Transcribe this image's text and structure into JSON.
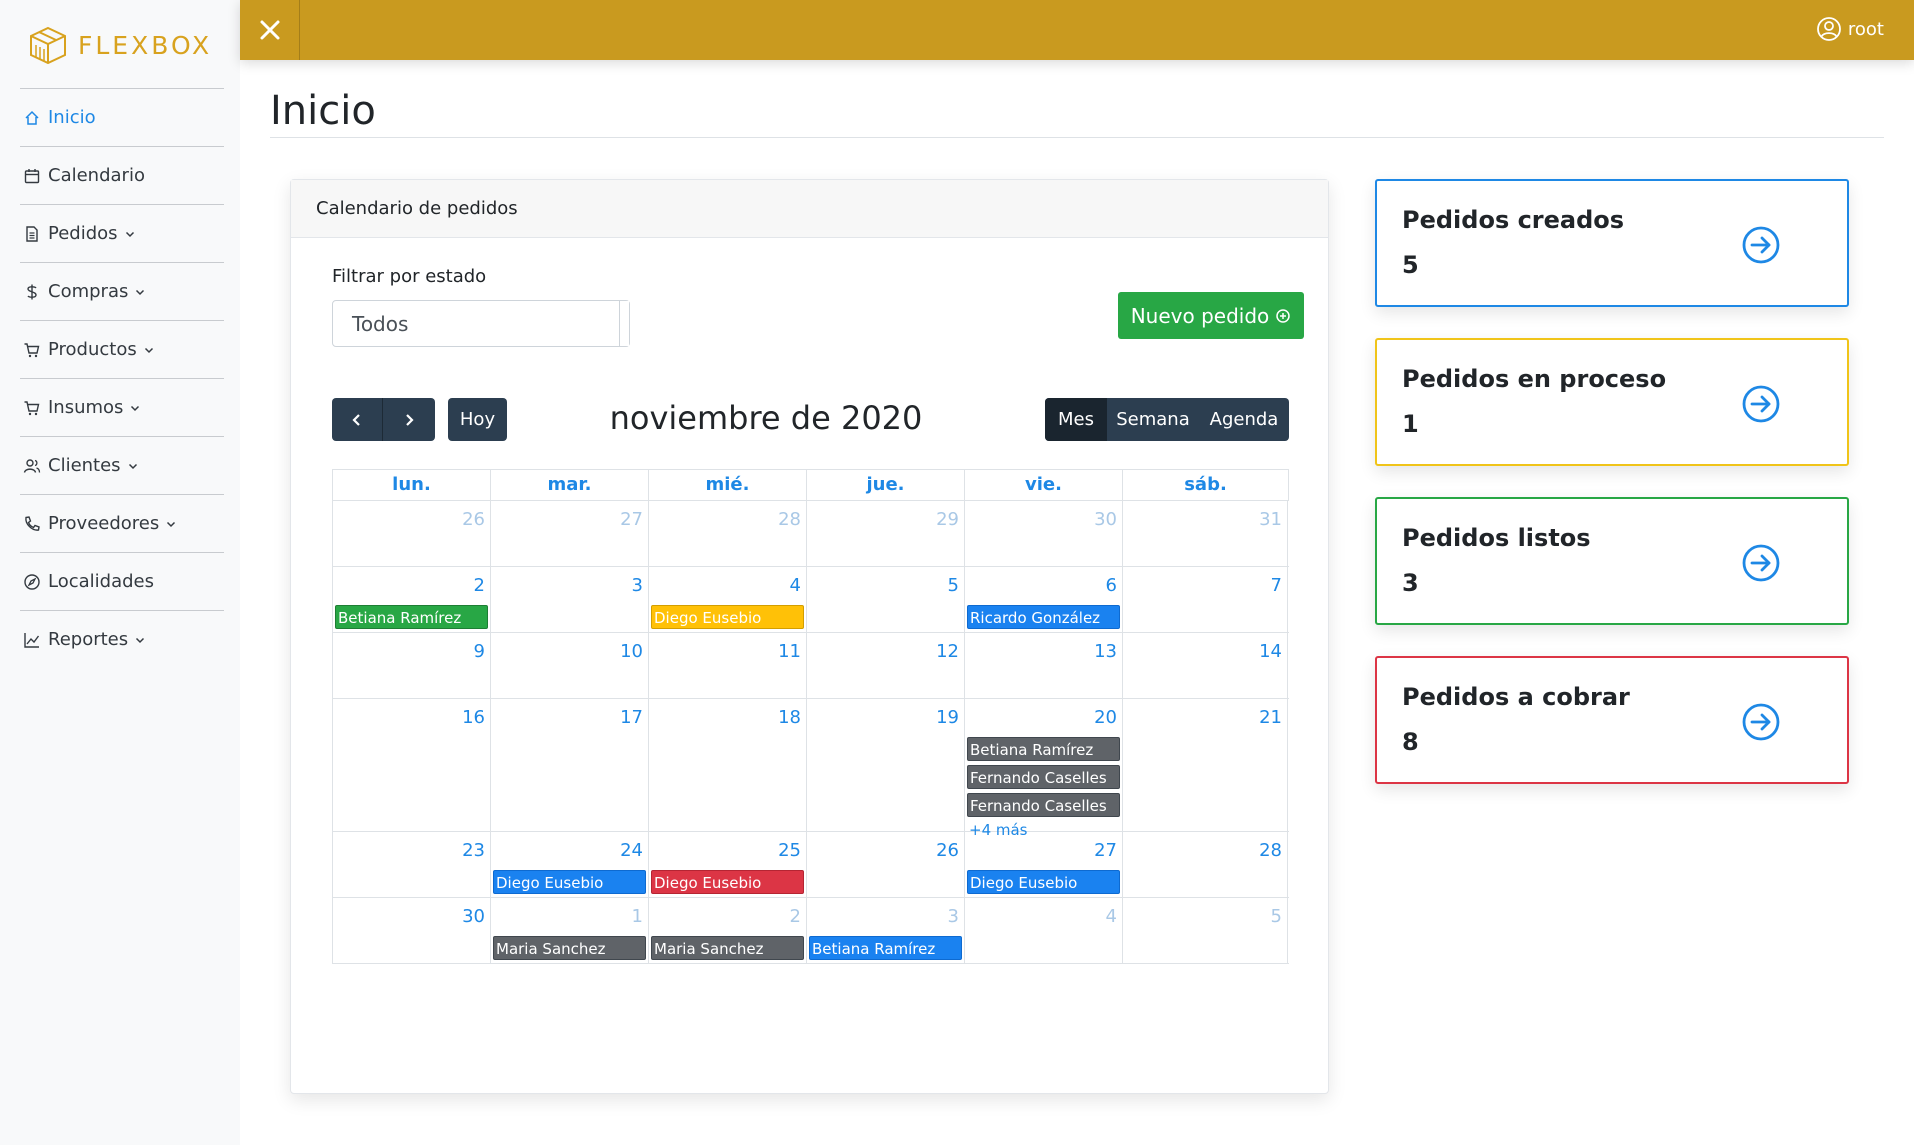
{
  "brand": {
    "name": "FLEXBOX"
  },
  "sidebar": {
    "items": [
      {
        "label": "Inicio",
        "icon": "home-icon",
        "active": true,
        "dropdown": false
      },
      {
        "label": "Calendario",
        "icon": "calendar-icon",
        "active": false,
        "dropdown": false
      },
      {
        "label": "Pedidos",
        "icon": "document-icon",
        "active": false,
        "dropdown": true
      },
      {
        "label": "Compras",
        "icon": "dollar-icon",
        "active": false,
        "dropdown": true
      },
      {
        "label": "Productos",
        "icon": "cart-icon",
        "active": false,
        "dropdown": true
      },
      {
        "label": "Insumos",
        "icon": "cart-icon",
        "active": false,
        "dropdown": true
      },
      {
        "label": "Clientes",
        "icon": "users-icon",
        "active": false,
        "dropdown": true
      },
      {
        "label": "Proveedores",
        "icon": "phone-icon",
        "active": false,
        "dropdown": true
      },
      {
        "label": "Localidades",
        "icon": "compass-icon",
        "active": false,
        "dropdown": false
      },
      {
        "label": "Reportes",
        "icon": "chart-line-icon",
        "active": false,
        "dropdown": true
      }
    ]
  },
  "topbar": {
    "user": "root",
    "color": "#c99a1f"
  },
  "page": {
    "title": "Inicio"
  },
  "calendar_card": {
    "header": "Calendario de pedidos",
    "filter_label": "Filtrar por estado",
    "filter_value": "Todos",
    "new_button": "Nuevo pedido",
    "today_button": "Hoy",
    "month_title": "noviembre de 2020",
    "views": [
      "Mes",
      "Semana",
      "Agenda"
    ],
    "active_view": "Mes",
    "weekdays": [
      "lun.",
      "mar.",
      "mié.",
      "jue.",
      "vie.",
      "sáb."
    ],
    "weeks": [
      {
        "days": [
          {
            "num": "26",
            "other": true,
            "events": []
          },
          {
            "num": "27",
            "other": true,
            "events": []
          },
          {
            "num": "28",
            "other": true,
            "events": []
          },
          {
            "num": "29",
            "other": true,
            "events": []
          },
          {
            "num": "30",
            "other": true,
            "events": []
          },
          {
            "num": "31",
            "other": true,
            "events": []
          }
        ]
      },
      {
        "days": [
          {
            "num": "2",
            "events": [
              {
                "name": "Betiana Ramírez",
                "color": "green"
              }
            ]
          },
          {
            "num": "3",
            "events": []
          },
          {
            "num": "4",
            "events": [
              {
                "name": "Diego Eusebio",
                "color": "yellow"
              }
            ]
          },
          {
            "num": "5",
            "events": []
          },
          {
            "num": "6",
            "events": [
              {
                "name": "Ricardo González",
                "color": "blue"
              }
            ]
          },
          {
            "num": "7",
            "events": []
          }
        ]
      },
      {
        "days": [
          {
            "num": "9",
            "events": []
          },
          {
            "num": "10",
            "events": []
          },
          {
            "num": "11",
            "events": []
          },
          {
            "num": "12",
            "events": []
          },
          {
            "num": "13",
            "events": []
          },
          {
            "num": "14",
            "events": []
          }
        ]
      },
      {
        "tall": true,
        "days": [
          {
            "num": "16",
            "events": []
          },
          {
            "num": "17",
            "events": []
          },
          {
            "num": "18",
            "events": []
          },
          {
            "num": "19",
            "events": []
          },
          {
            "num": "20",
            "events": [
              {
                "name": "Betiana Ramírez",
                "color": "gray"
              },
              {
                "name": "Fernando Caselles",
                "color": "gray"
              },
              {
                "name": "Fernando Caselles",
                "color": "gray"
              }
            ],
            "more": "+4 más"
          },
          {
            "num": "21",
            "events": []
          }
        ]
      },
      {
        "days": [
          {
            "num": "23",
            "events": []
          },
          {
            "num": "24",
            "events": [
              {
                "name": "Diego Eusebio",
                "color": "blue"
              }
            ]
          },
          {
            "num": "25",
            "events": [
              {
                "name": "Diego Eusebio",
                "color": "red"
              }
            ]
          },
          {
            "num": "26",
            "events": []
          },
          {
            "num": "27",
            "events": [
              {
                "name": "Diego Eusebio",
                "color": "blue"
              }
            ]
          },
          {
            "num": "28",
            "events": []
          }
        ]
      },
      {
        "days": [
          {
            "num": "30",
            "events": []
          },
          {
            "num": "1",
            "other": true,
            "events": [
              {
                "name": "Maria Sanchez",
                "color": "gray"
              }
            ]
          },
          {
            "num": "2",
            "other": true,
            "events": [
              {
                "name": "Maria Sanchez",
                "color": "gray"
              }
            ]
          },
          {
            "num": "3",
            "other": true,
            "events": [
              {
                "name": "Betiana Ramírez",
                "color": "blue"
              }
            ]
          },
          {
            "num": "4",
            "other": true,
            "events": []
          },
          {
            "num": "5",
            "other": true,
            "events": []
          }
        ]
      }
    ]
  },
  "stats": [
    {
      "title": "Pedidos creados",
      "value": "5",
      "color": "#1e88e5"
    },
    {
      "title": "Pedidos en proceso",
      "value": "1",
      "color": "#f0c419"
    },
    {
      "title": "Pedidos listos",
      "value": "3",
      "color": "#28a745"
    },
    {
      "title": "Pedidos a cobrar",
      "value": "8",
      "color": "#dc3545"
    }
  ]
}
